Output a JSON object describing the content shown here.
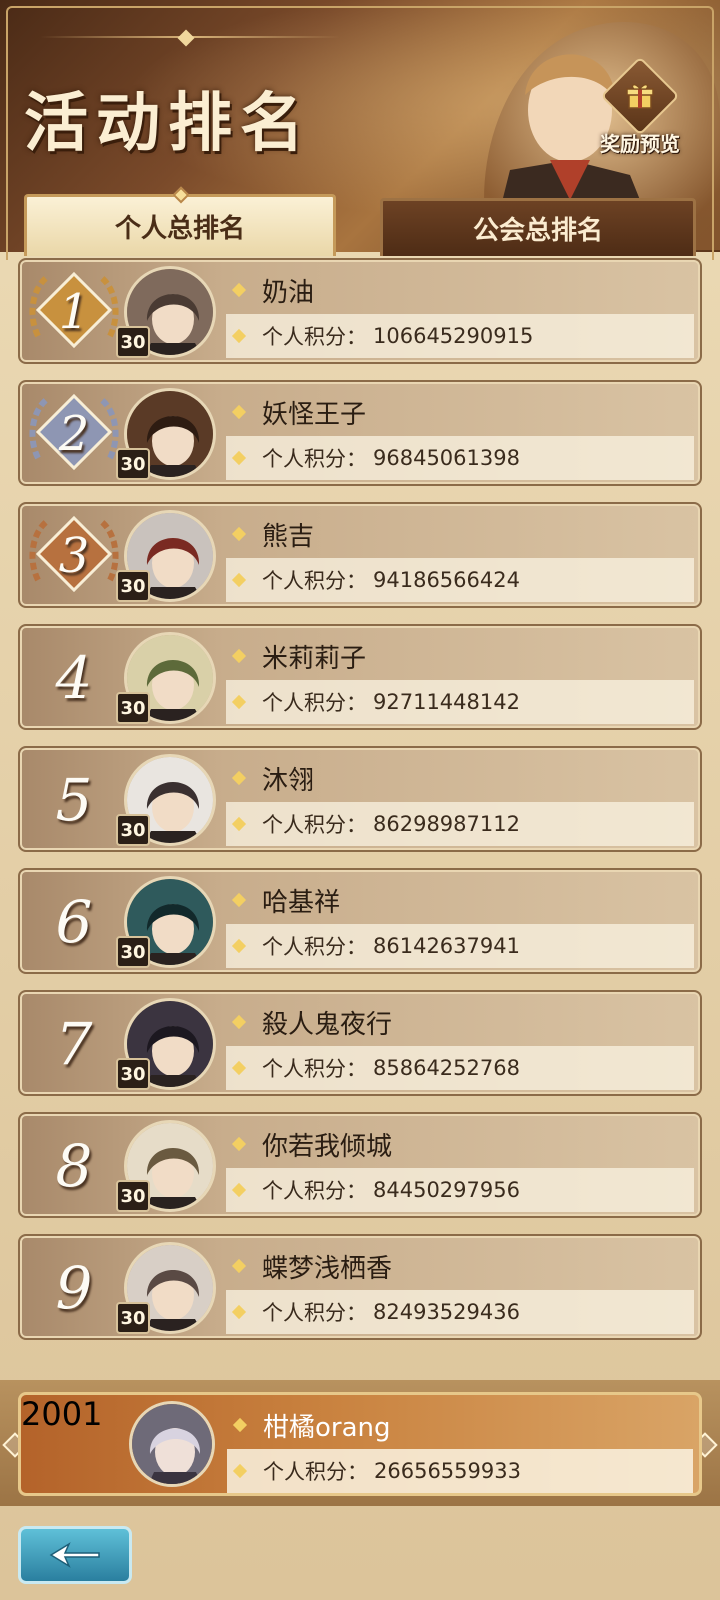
{
  "header": {
    "title": "活动排名",
    "reward_label": "奖励预览"
  },
  "tabs": [
    {
      "label": "个人总排名",
      "active": true
    },
    {
      "label": "公会总排名",
      "active": false
    }
  ],
  "score_label": "个人积分：",
  "rankings": [
    {
      "rank": "1",
      "name": "奶油",
      "level": "30",
      "score": "106645290915",
      "medal": "gold"
    },
    {
      "rank": "2",
      "name": "妖怪王子",
      "level": "30",
      "score": "96845061398",
      "medal": "silver"
    },
    {
      "rank": "3",
      "name": "熊吉",
      "level": "30",
      "score": "94186566424",
      "medal": "bronze"
    },
    {
      "rank": "4",
      "name": "米莉莉子",
      "level": "30",
      "score": "92711448142"
    },
    {
      "rank": "5",
      "name": "沐翎",
      "level": "30",
      "score": "86298987112"
    },
    {
      "rank": "6",
      "name": "哈基祥",
      "level": "30",
      "score": "86142637941"
    },
    {
      "rank": "7",
      "name": "殺人鬼夜行",
      "level": "30",
      "score": "85864252768"
    },
    {
      "rank": "8",
      "name": "你若我倾城",
      "level": "30",
      "score": "84450297956"
    },
    {
      "rank": "9",
      "name": "蝶梦浅栖香",
      "level": "30",
      "score": "82493529436"
    }
  ],
  "my_rank": {
    "rank": "2001",
    "name": "柑橘orang",
    "score": "26656559933"
  },
  "colors": {
    "gold": "#c8913e",
    "silver": "#8e96b3",
    "bronze": "#b7713f",
    "accent": "#f3cf62"
  }
}
